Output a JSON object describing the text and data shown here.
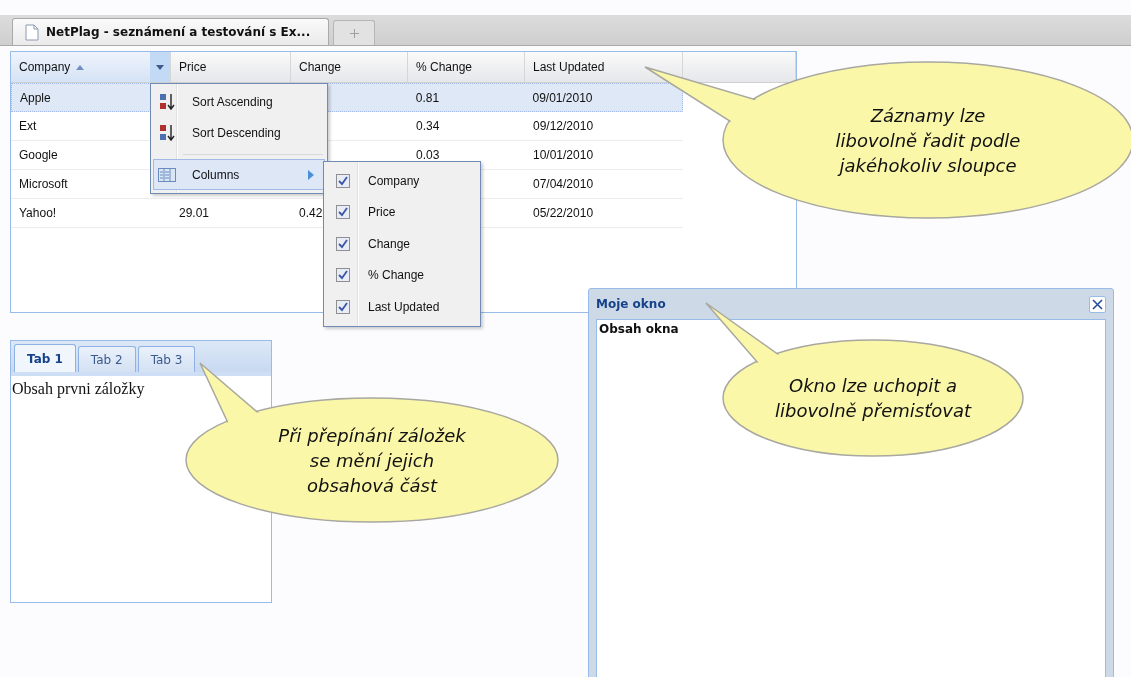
{
  "browser_tab": {
    "title": "NetPlag - seznámení a testování s Ex..."
  },
  "grid": {
    "columns": [
      {
        "label": "Company",
        "sorted": true
      },
      {
        "label": "Price",
        "sorted": false
      },
      {
        "label": "Change",
        "sorted": false
      },
      {
        "label": "% Change",
        "sorted": false
      },
      {
        "label": "Last Updated",
        "sorted": false
      }
    ],
    "rows": [
      {
        "selected": true,
        "cells": [
          "Apple",
          null,
          null,
          "0.81",
          "09/01/2010"
        ]
      },
      {
        "selected": false,
        "cells": [
          "Ext",
          null,
          null,
          "0.34",
          "09/12/2010"
        ]
      },
      {
        "selected": false,
        "cells": [
          "Google",
          null,
          null,
          "0.03",
          "10/01/2010"
        ]
      },
      {
        "selected": false,
        "cells": [
          "Microsoft",
          null,
          null,
          null,
          "07/04/2010"
        ]
      },
      {
        "selected": false,
        "cells": [
          "Yahoo!",
          "29.01",
          "0.42",
          null,
          "05/22/2010"
        ]
      }
    ],
    "menu": {
      "items": [
        {
          "kind": "sort-asc",
          "label": "Sort Ascending",
          "selected": false
        },
        {
          "kind": "sort-desc",
          "label": "Sort Descending",
          "selected": false
        },
        {
          "kind": "columns",
          "label": "Columns",
          "selected": true
        }
      ]
    },
    "columns_menu": {
      "items": [
        {
          "label": "Company",
          "checked": true
        },
        {
          "label": "Price",
          "checked": true
        },
        {
          "label": "Change",
          "checked": true
        },
        {
          "label": "% Change",
          "checked": true
        },
        {
          "label": "Last Updated",
          "checked": true
        }
      ]
    }
  },
  "tab_panel": {
    "tabs": [
      {
        "label": "Tab 1",
        "selected": true
      },
      {
        "label": "Tab 2",
        "selected": false
      },
      {
        "label": "Tab 3",
        "selected": false
      }
    ],
    "content": "Obsah prvni záložky"
  },
  "window": {
    "title": "Moje okno",
    "content": "Obsah okna"
  },
  "callouts": [
    "Záznamy lze\nlibovolně řadit podle\njakéhokoliv sloupce",
    "Při přepínání záložek\nse mění jejich\nobsahová část",
    "Okno lze uchopit a\nlibovolně přemisťovat"
  ]
}
